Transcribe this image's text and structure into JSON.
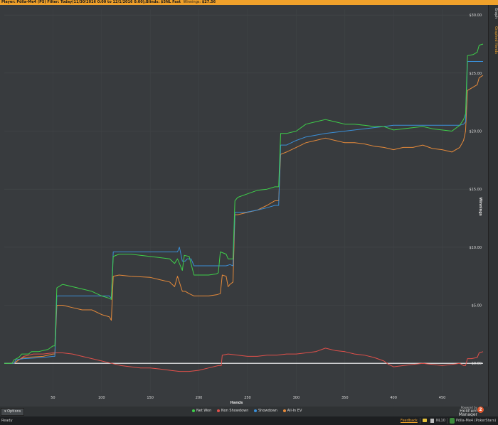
{
  "header": {
    "player_label": "Player:",
    "player_value": "Pölla-Me4 (PS)",
    "filter_label": "Filter:",
    "filter_value": "Today(11/30/2016 0:00 to 12/1/2016 0:00);Blinds: $5NL Fast",
    "winnings_label": "Winnings:",
    "winnings_value": "$27.56"
  },
  "right_tabs": {
    "graph": "Graph",
    "graphed_hands": "Graphed Hands"
  },
  "options_label": "Options",
  "brand": {
    "powered": "Powered by",
    "name": "Hold'em Manager",
    "logo": "2"
  },
  "status": {
    "ready": "Ready",
    "feedback": "Feedback",
    "db": "NL10",
    "player": "Pölla-Me4 (PokerStars)"
  },
  "colors": {
    "net_won": "#3ecf4a",
    "non_showdown": "#e0504a",
    "showdown": "#3a8fd8",
    "allin_ev": "#e68a3a",
    "zero_line": "#ffffff"
  },
  "chart_data": {
    "type": "line",
    "xlabel": "Hands",
    "ylabel": "Winnings",
    "xlim": [
      0,
      492
    ],
    "ylim": [
      -2.5,
      30.5
    ],
    "x_ticks": [
      50,
      100,
      150,
      200,
      250,
      300,
      350,
      400,
      450
    ],
    "y_ticks": [
      "$30.00",
      "$25.00",
      "$20.00",
      "$15.00",
      "$10.00",
      "$5.00",
      "$0.00"
    ],
    "y_tick_values": [
      30,
      25,
      20,
      15,
      10,
      5,
      0
    ],
    "series": [
      {
        "name": "Net Won",
        "color_key": "net_won",
        "points": [
          [
            0,
            0
          ],
          [
            8,
            0
          ],
          [
            10,
            0.3
          ],
          [
            15,
            0.5
          ],
          [
            18,
            0.8
          ],
          [
            25,
            0.8
          ],
          [
            28,
            1.0
          ],
          [
            35,
            1.0
          ],
          [
            45,
            1.2
          ],
          [
            50,
            1.5
          ],
          [
            52,
            1.5
          ],
          [
            54,
            6.5
          ],
          [
            58,
            6.7
          ],
          [
            60,
            6.8
          ],
          [
            70,
            6.6
          ],
          [
            80,
            6.4
          ],
          [
            90,
            6.2
          ],
          [
            100,
            5.8
          ],
          [
            108,
            5.6
          ],
          [
            110,
            5.5
          ],
          [
            112,
            9.2
          ],
          [
            118,
            9.4
          ],
          [
            130,
            9.4
          ],
          [
            140,
            9.3
          ],
          [
            150,
            9.2
          ],
          [
            160,
            9.1
          ],
          [
            170,
            9.0
          ],
          [
            175,
            8.6
          ],
          [
            178,
            9.0
          ],
          [
            183,
            8.0
          ],
          [
            185,
            9.3
          ],
          [
            190,
            9.2
          ],
          [
            195,
            7.6
          ],
          [
            200,
            7.6
          ],
          [
            210,
            7.6
          ],
          [
            218,
            7.7
          ],
          [
            220,
            7.8
          ],
          [
            222,
            9.6
          ],
          [
            228,
            9.4
          ],
          [
            230,
            9.0
          ],
          [
            235,
            9.0
          ],
          [
            237,
            14.0
          ],
          [
            240,
            14.3
          ],
          [
            250,
            14.6
          ],
          [
            260,
            14.9
          ],
          [
            270,
            15.0
          ],
          [
            278,
            15.2
          ],
          [
            282,
            15.2
          ],
          [
            284,
            19.8
          ],
          [
            290,
            19.8
          ],
          [
            300,
            20.0
          ],
          [
            310,
            20.6
          ],
          [
            320,
            20.8
          ],
          [
            330,
            21.0
          ],
          [
            340,
            20.8
          ],
          [
            350,
            20.6
          ],
          [
            360,
            20.6
          ],
          [
            370,
            20.5
          ],
          [
            380,
            20.4
          ],
          [
            390,
            20.4
          ],
          [
            400,
            20.1
          ],
          [
            410,
            20.2
          ],
          [
            420,
            20.3
          ],
          [
            430,
            20.4
          ],
          [
            440,
            20.2
          ],
          [
            450,
            20.1
          ],
          [
            460,
            20.0
          ],
          [
            468,
            20.5
          ],
          [
            472,
            21.0
          ],
          [
            474,
            21.5
          ],
          [
            476,
            26.5
          ],
          [
            482,
            26.6
          ],
          [
            486,
            26.8
          ],
          [
            488,
            27.4
          ],
          [
            492,
            27.5
          ]
        ]
      },
      {
        "name": "Non Showdown",
        "color_key": "non_showdown",
        "points": [
          [
            0,
            0
          ],
          [
            10,
            0
          ],
          [
            15,
            0.3
          ],
          [
            20,
            0.6
          ],
          [
            30,
            0.8
          ],
          [
            40,
            0.8
          ],
          [
            50,
            0.9
          ],
          [
            60,
            0.9
          ],
          [
            70,
            0.8
          ],
          [
            80,
            0.6
          ],
          [
            90,
            0.4
          ],
          [
            100,
            0.2
          ],
          [
            110,
            0
          ],
          [
            120,
            -0.2
          ],
          [
            130,
            -0.3
          ],
          [
            140,
            -0.4
          ],
          [
            150,
            -0.4
          ],
          [
            160,
            -0.5
          ],
          [
            170,
            -0.6
          ],
          [
            180,
            -0.7
          ],
          [
            190,
            -0.7
          ],
          [
            200,
            -0.6
          ],
          [
            210,
            -0.4
          ],
          [
            220,
            -0.2
          ],
          [
            223,
            -0.2
          ],
          [
            224,
            0.7
          ],
          [
            230,
            0.8
          ],
          [
            240,
            0.7
          ],
          [
            250,
            0.6
          ],
          [
            260,
            0.6
          ],
          [
            270,
            0.7
          ],
          [
            280,
            0.7
          ],
          [
            290,
            0.8
          ],
          [
            300,
            0.8
          ],
          [
            310,
            0.9
          ],
          [
            320,
            1.0
          ],
          [
            330,
            1.3
          ],
          [
            340,
            1.1
          ],
          [
            350,
            1.0
          ],
          [
            360,
            0.8
          ],
          [
            370,
            0.7
          ],
          [
            380,
            0.5
          ],
          [
            390,
            0.2
          ],
          [
            395,
            -0.1
          ],
          [
            400,
            -0.3
          ],
          [
            410,
            -0.2
          ],
          [
            420,
            -0.1
          ],
          [
            430,
            0
          ],
          [
            440,
            -0.1
          ],
          [
            450,
            -0.2
          ],
          [
            460,
            -0.1
          ],
          [
            468,
            0
          ],
          [
            472,
            -0.2
          ],
          [
            474,
            -0.2
          ],
          [
            476,
            0.4
          ],
          [
            480,
            0.4
          ],
          [
            486,
            0.5
          ],
          [
            488,
            0.9
          ],
          [
            492,
            1.0
          ]
        ]
      },
      {
        "name": "Showdown",
        "color_key": "showdown",
        "points": [
          [
            0,
            0
          ],
          [
            10,
            0
          ],
          [
            12,
            0.3
          ],
          [
            20,
            0.4
          ],
          [
            40,
            0.5
          ],
          [
            50,
            0.6
          ],
          [
            52,
            0.6
          ],
          [
            54,
            5.8
          ],
          [
            60,
            5.8
          ],
          [
            100,
            5.8
          ],
          [
            108,
            5.8
          ],
          [
            110,
            5.6
          ],
          [
            112,
            9.6
          ],
          [
            130,
            9.6
          ],
          [
            150,
            9.6
          ],
          [
            170,
            9.6
          ],
          [
            178,
            9.6
          ],
          [
            180,
            10.0
          ],
          [
            183,
            8.8
          ],
          [
            186,
            8.8
          ],
          [
            188,
            9.0
          ],
          [
            192,
            9.0
          ],
          [
            195,
            8.4
          ],
          [
            220,
            8.4
          ],
          [
            224,
            8.4
          ],
          [
            228,
            8.4
          ],
          [
            232,
            8.5
          ],
          [
            235,
            8.4
          ],
          [
            237,
            13.0
          ],
          [
            248,
            13.0
          ],
          [
            260,
            13.2
          ],
          [
            270,
            13.4
          ],
          [
            278,
            13.6
          ],
          [
            282,
            13.6
          ],
          [
            284,
            18.8
          ],
          [
            290,
            18.8
          ],
          [
            300,
            19.2
          ],
          [
            310,
            19.5
          ],
          [
            330,
            19.8
          ],
          [
            350,
            20.0
          ],
          [
            370,
            20.2
          ],
          [
            390,
            20.4
          ],
          [
            400,
            20.5
          ],
          [
            420,
            20.5
          ],
          [
            440,
            20.5
          ],
          [
            460,
            20.5
          ],
          [
            468,
            20.5
          ],
          [
            472,
            20.6
          ],
          [
            474,
            20.8
          ],
          [
            476,
            26.0
          ],
          [
            492,
            26.0
          ]
        ]
      },
      {
        "name": "All-In EV",
        "color_key": "allin_ev",
        "points": [
          [
            0,
            0
          ],
          [
            10,
            0
          ],
          [
            15,
            0.3
          ],
          [
            20,
            0.5
          ],
          [
            40,
            0.6
          ],
          [
            50,
            0.8
          ],
          [
            52,
            0.8
          ],
          [
            54,
            5.0
          ],
          [
            60,
            5.0
          ],
          [
            70,
            4.8
          ],
          [
            80,
            4.6
          ],
          [
            90,
            4.6
          ],
          [
            100,
            4.2
          ],
          [
            108,
            4.0
          ],
          [
            110,
            3.7
          ],
          [
            112,
            7.5
          ],
          [
            118,
            7.6
          ],
          [
            130,
            7.5
          ],
          [
            150,
            7.4
          ],
          [
            160,
            7.2
          ],
          [
            170,
            7.0
          ],
          [
            175,
            6.6
          ],
          [
            178,
            7.5
          ],
          [
            183,
            6.2
          ],
          [
            186,
            6.2
          ],
          [
            190,
            6.0
          ],
          [
            195,
            5.8
          ],
          [
            200,
            5.8
          ],
          [
            210,
            5.8
          ],
          [
            218,
            5.9
          ],
          [
            222,
            6.0
          ],
          [
            224,
            7.6
          ],
          [
            228,
            7.5
          ],
          [
            230,
            6.6
          ],
          [
            232,
            6.8
          ],
          [
            235,
            7.0
          ],
          [
            237,
            12.8
          ],
          [
            240,
            12.8
          ],
          [
            250,
            13.0
          ],
          [
            260,
            13.2
          ],
          [
            270,
            13.6
          ],
          [
            278,
            14.0
          ],
          [
            282,
            14.0
          ],
          [
            284,
            18.0
          ],
          [
            290,
            18.2
          ],
          [
            300,
            18.6
          ],
          [
            310,
            19.0
          ],
          [
            320,
            19.2
          ],
          [
            330,
            19.4
          ],
          [
            340,
            19.2
          ],
          [
            350,
            19.0
          ],
          [
            360,
            19.0
          ],
          [
            370,
            18.9
          ],
          [
            380,
            18.7
          ],
          [
            390,
            18.6
          ],
          [
            400,
            18.4
          ],
          [
            410,
            18.6
          ],
          [
            420,
            18.6
          ],
          [
            430,
            18.8
          ],
          [
            440,
            18.5
          ],
          [
            450,
            18.4
          ],
          [
            460,
            18.2
          ],
          [
            468,
            18.6
          ],
          [
            472,
            19.2
          ],
          [
            474,
            20.0
          ],
          [
            476,
            23.5
          ],
          [
            482,
            23.8
          ],
          [
            486,
            24.0
          ],
          [
            488,
            24.6
          ],
          [
            492,
            24.8
          ]
        ]
      }
    ]
  }
}
